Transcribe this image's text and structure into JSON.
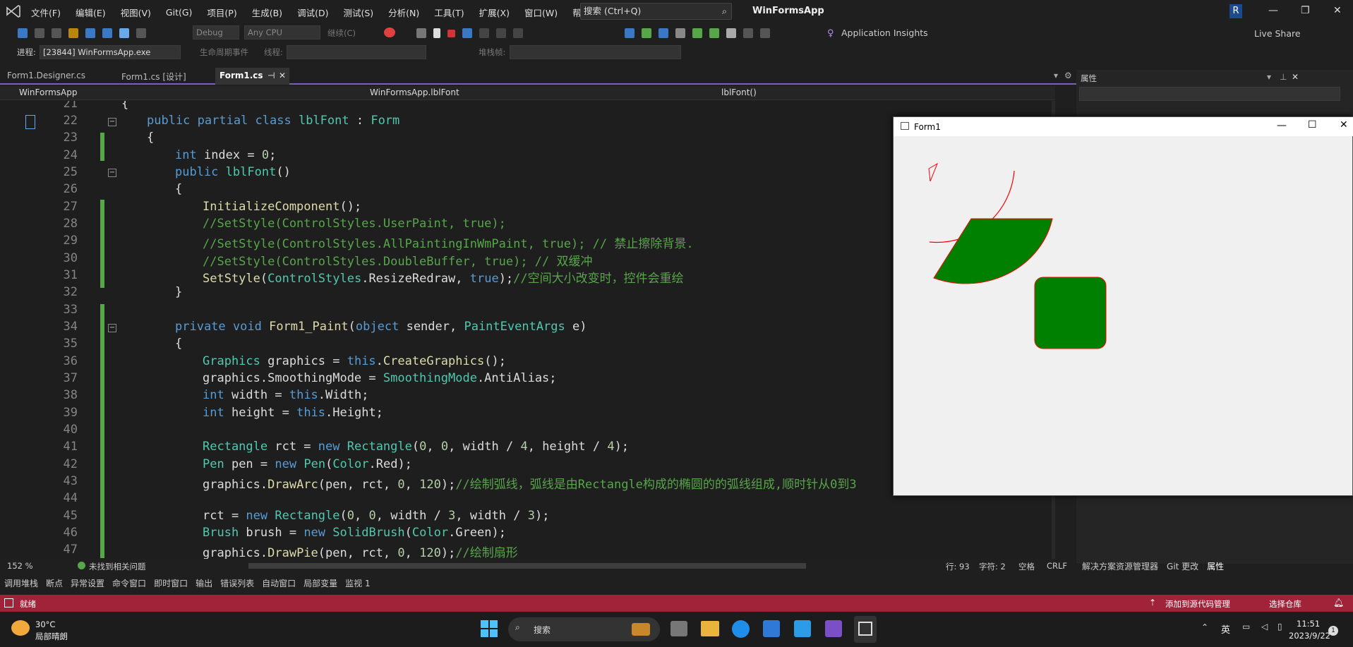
{
  "titlebar": {
    "menus": [
      "文件(F)",
      "编辑(E)",
      "视图(V)",
      "Git(G)",
      "项目(P)",
      "生成(B)",
      "调试(D)",
      "测试(S)",
      "分析(N)",
      "工具(T)",
      "扩展(X)",
      "窗口(W)",
      "帮助(H)"
    ],
    "search": "搜索 (Ctrl+Q)",
    "app_title": "WinFormsApp",
    "avatar": "R"
  },
  "toolbar": {
    "config": "Debug",
    "platform": "Any CPU",
    "continue": "继续(C)",
    "app_insights": "Application Insights",
    "live_share": "Live Share"
  },
  "toolbar2": {
    "process_label": "进程:",
    "process_value": "[23844] WinFormsApp.exe",
    "lifecycle": "生命周期事件",
    "thread_label": "线程:",
    "stackframe_label": "堆栈帧:"
  },
  "tabs": [
    "Form1.Designer.cs",
    "Form1.cs [设计]",
    "Form1.cs"
  ],
  "nav": {
    "project": "WinFormsApp",
    "class": "WinFormsApp.lblFont",
    "member": "lblFont()"
  },
  "editor": {
    "line_numbers": [
      "21",
      "22",
      "23",
      "24",
      "25",
      "26",
      "27",
      "28",
      "29",
      "30",
      "31",
      "32",
      "33",
      "34",
      "35",
      "36",
      "37",
      "38",
      "39",
      "40",
      "41",
      "42",
      "43",
      "44",
      "45",
      "46",
      "47"
    ],
    "zoom": "152 %",
    "issues": "未找到相关问题",
    "line": "行: 93",
    "col": "字符: 2",
    "spaces": "空格",
    "eol": "CRLF"
  },
  "properties": {
    "title": "属性",
    "tabs": [
      "解决方案资源管理器",
      "Git 更改",
      "属性"
    ]
  },
  "form1": {
    "title": "Form1"
  },
  "bottom_tabs": [
    "调用堆栈",
    "断点",
    "异常设置",
    "命令窗口",
    "即时窗口",
    "输出",
    "错误列表",
    "自动窗口",
    "局部变量",
    "监视 1"
  ],
  "status": {
    "ready": "就绪",
    "add_source": "添加到源代码管理",
    "select_repo": "选择仓库"
  },
  "taskbar": {
    "temp": "30°C",
    "weather": "局部晴朗",
    "search": "搜索",
    "lang": "英",
    "time": "11:51",
    "date": "2023/9/22"
  },
  "colors": {
    "accent": "#7a5ec2",
    "status_bar": "#a0233a",
    "shape_fill": "#008000",
    "arc_pen": "#ff0000"
  }
}
